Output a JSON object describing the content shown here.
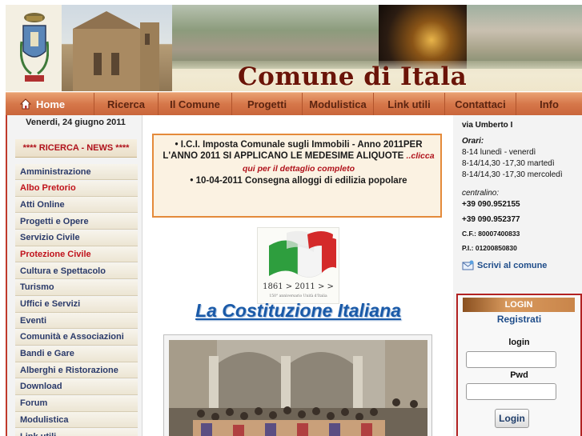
{
  "header": {
    "title": "Comune di Itala"
  },
  "nav": {
    "items": [
      {
        "label": "Home",
        "icon": "home-icon"
      },
      {
        "label": "Ricerca"
      },
      {
        "label": "Il Comune"
      },
      {
        "label": "Progetti"
      },
      {
        "label": "Modulistica"
      },
      {
        "label": "Link utili"
      },
      {
        "label": "Contattaci"
      },
      {
        "label": "Info"
      }
    ]
  },
  "left": {
    "date": "Venerdi, 24 giugno 2011",
    "news_label": "**** RICERCA - NEWS ****",
    "menu": [
      {
        "label": "Amministrazione"
      },
      {
        "label": "Albo Pretorio"
      },
      {
        "label": "Atti Online"
      },
      {
        "label": "Progetti e Opere"
      },
      {
        "label": "Servizio Civile"
      },
      {
        "label": "Protezione Civile"
      },
      {
        "label": "Cultura e Spettacolo"
      },
      {
        "label": "Turismo"
      },
      {
        "label": "Uffici e Servizi"
      },
      {
        "label": "Eventi"
      },
      {
        "label": "Comunità e Associazioni"
      },
      {
        "label": "Bandi e Gare"
      },
      {
        "label": "Alberghi e Ristorazione"
      },
      {
        "label": "Download"
      },
      {
        "label": "Forum"
      },
      {
        "label": "Modulistica"
      },
      {
        "label": "Link utili"
      }
    ]
  },
  "center": {
    "news": {
      "line1": "• I.C.I. Imposta Comunale sugli Immobili - Anno 2011PER",
      "line2": "L'ANNO 2011 SI APPLICANO LE MEDESIME ALIQUOTE",
      "clicca": "..clicca",
      "line3": "qui per il dettaglio completo",
      "line4": "• 10-04-2011 Consegna alloggi di edilizia popolare"
    },
    "logo": {
      "years": "1861 > 2011 > >",
      "caption": "150° anniversario Unità d'Italia"
    },
    "costituzione_link": "La Costituzione Italiana"
  },
  "right": {
    "address": "via Umberto I",
    "orari_label": "Orari:",
    "orari": [
      "8-14 lunedì - venerdì",
      "8-14/14,30 -17,30 martedì",
      "8-14/14,30 -17,30 mercoledì"
    ],
    "centralino_label": "centralino:",
    "phones": [
      "+39 090.952155",
      "+39 090.952377"
    ],
    "cf": "C.F.: 80007400833",
    "pi": "P.I.: 01200850830",
    "scrivi": "Scrivi al comune",
    "login": {
      "header": "LOGIN",
      "registrati": "Registrati",
      "login_label": "login",
      "pwd_label": "Pwd",
      "login_value": "",
      "pwd_value": "",
      "button": "Login"
    }
  },
  "colors": {
    "nav": "#d6774a",
    "title": "#6a1408",
    "accent_red": "#c0121b",
    "link_blue": "#1a5aa8"
  }
}
